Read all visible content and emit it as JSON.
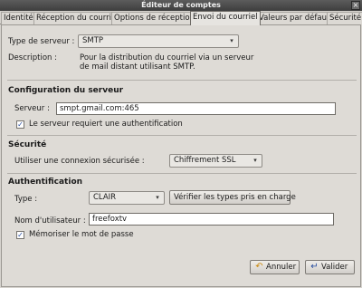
{
  "window": {
    "title": "Éditeur de comptes",
    "close_glyph": "×"
  },
  "tabs": [
    {
      "label": "Identité"
    },
    {
      "label": "Réception du courriel"
    },
    {
      "label": "Options de réception"
    },
    {
      "label": "Envoi du courriel"
    },
    {
      "label": "Valeurs par défaut"
    },
    {
      "label": "Sécurité"
    }
  ],
  "server_type": {
    "label": "Type de serveur :",
    "value": "SMTP",
    "arrow_icon": "chevron-down-icon"
  },
  "description": {
    "label": "Description :",
    "line1": "Pour la distribution du courriel via un serveur",
    "line2": "de mail distant utilisant SMTP."
  },
  "config": {
    "heading": "Configuration du serveur",
    "server_label": "Serveur :",
    "server_value": "smpt.gmail.com:465",
    "auth_required_label": "Le serveur requiert une authentification",
    "auth_required_checked": true
  },
  "security": {
    "heading": "Sécurité",
    "connection_label": "Utiliser une connexion sécurisée :",
    "connection_value": "Chiffrement SSL"
  },
  "auth": {
    "heading": "Authentification",
    "type_label": "Type :",
    "type_value": "CLAIR",
    "check_types_button": "Vérifier les types pris en charge",
    "username_label": "Nom d'utilisateur :",
    "username_value": "freefoxtv",
    "remember_password_label": "Mémoriser le mot de passe",
    "remember_password_checked": true
  },
  "footer": {
    "cancel_label": "Annuler",
    "cancel_icon": "undo-arrow-icon",
    "validate_label": "Valider",
    "validate_icon": "enter-arrow-icon",
    "accent_color": "#244a9e"
  }
}
